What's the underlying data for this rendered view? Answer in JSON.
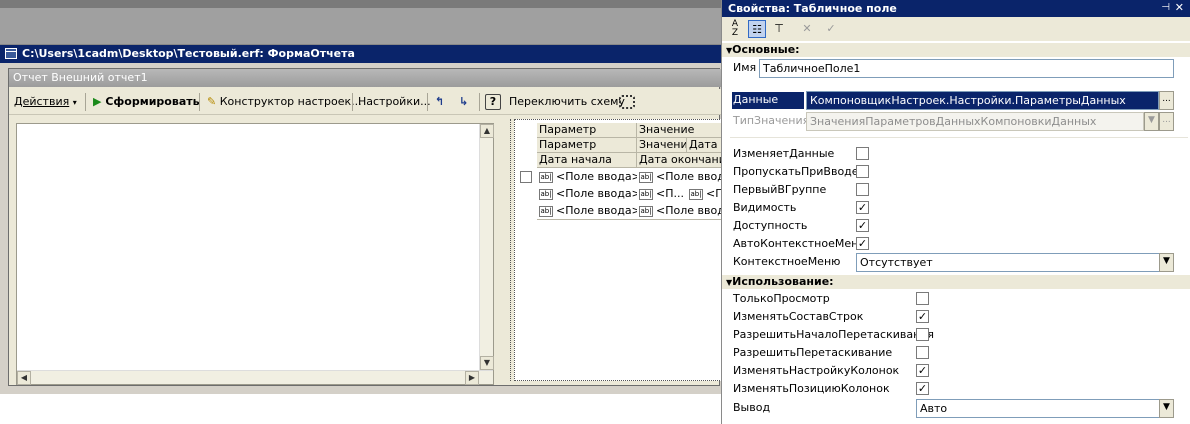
{
  "designer": {
    "title": "C:\\Users\\1cadm\\Desktop\\Тестовый.erf: ФормаОтчета"
  },
  "form": {
    "title": "Отчет  Внешний отчет1",
    "toolbar": {
      "actions_label": "Действия",
      "generate_label": "Сформировать",
      "constructor_label": "Конструктор настроек...",
      "settings_label": "Настройки...",
      "help_label": "?",
      "switch_scheme_label": "Переключить схему"
    },
    "grid": {
      "headers_row1": [
        "Параметр",
        "Значение"
      ],
      "headers_row2": [
        "Параметр",
        "Значение",
        "Дата"
      ],
      "headers_row3": [
        "Дата начала",
        "Дата окончания"
      ],
      "field_placeholder": "<Поле ввода>",
      "field_short": "<П...",
      "field_short2": "<П..."
    }
  },
  "props": {
    "title": "Свойства: Табличное поле",
    "section_main": "Основные:",
    "section_usage": "Использование:",
    "name_label": "Имя",
    "name_value": "ТабличноеПоле1",
    "data_label": "Данные",
    "data_value": "КомпоновщикНастроек.Настройки.ПараметрыДанных",
    "type_label": "ТипЗначения",
    "type_value": "ЗначенияПараметровДанныхКомпоновкиДанных",
    "main_flags": [
      {
        "label": "ИзменяетДанные",
        "checked": false
      },
      {
        "label": "ПропускатьПриВводе",
        "checked": false
      },
      {
        "label": "ПервыйВГруппе",
        "checked": false
      },
      {
        "label": "Видимость",
        "checked": true
      },
      {
        "label": "Доступность",
        "checked": true
      },
      {
        "label": "АвтоКонтекстноеМеню",
        "checked": true
      }
    ],
    "context_menu_label": "КонтекстноеМеню",
    "context_menu_value": "Отсутствует",
    "usage_flags": [
      {
        "label": "ТолькоПросмотр",
        "checked": false
      },
      {
        "label": "ИзменятьСоставСтрок",
        "checked": true
      },
      {
        "label": "РазрешитьНачалоПеретаскивания",
        "checked": false
      },
      {
        "label": "РазрешитьПеретаскивание",
        "checked": false
      },
      {
        "label": "ИзменятьНастройкуКолонок",
        "checked": true
      },
      {
        "label": "ИзменятьПозициюКолонок",
        "checked": true
      }
    ],
    "output_label": "Вывод",
    "output_value": "Авто",
    "ellipsis": "..."
  },
  "colors": {
    "title_bar": "#0a246a",
    "panel_bg": "#ece9d8",
    "selection": "#0a246a"
  }
}
